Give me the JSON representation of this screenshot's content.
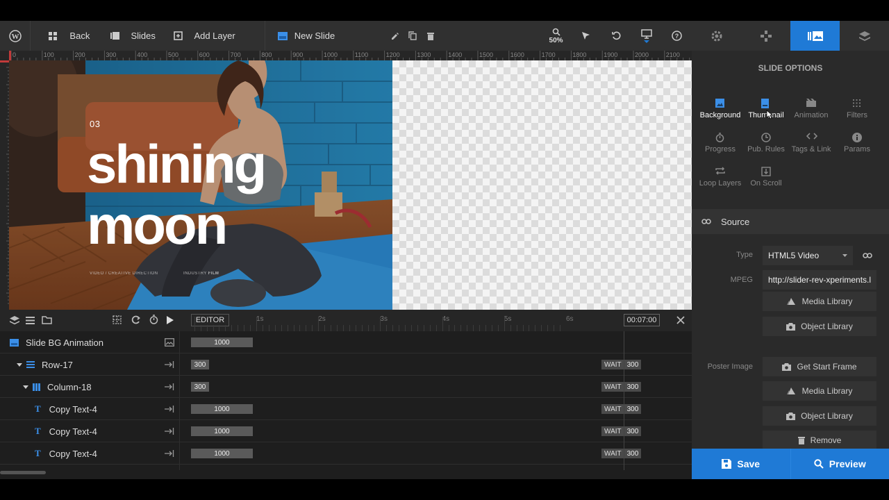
{
  "toolbar": {
    "back_label": "Back",
    "slides_label": "Slides",
    "add_layer_label": "Add Layer",
    "slide_name": "New Slide",
    "zoom": "50%"
  },
  "ruler": {
    "ticks": [
      "0",
      "100",
      "200",
      "300",
      "400",
      "500",
      "600",
      "700",
      "800",
      "900",
      "1000",
      "1100",
      "1200",
      "1300",
      "1400",
      "1500",
      "1600",
      "1700",
      "1800",
      "1900",
      "2000",
      "2100"
    ]
  },
  "slide": {
    "number": "03",
    "headline_line1": "shining",
    "headline_line2": "moon",
    "caption_left": "VIDEO / CREATIVE DIRECTION",
    "caption_right_a": "INDUSTRY",
    "caption_right_b": "FILM"
  },
  "timeline": {
    "editor_label": "EDITOR",
    "time_marks": [
      "1s",
      "2s",
      "3s",
      "4s",
      "5s",
      "6s"
    ],
    "time_display": "00:07:00",
    "rows": [
      {
        "name": "Slide BG Animation",
        "bar": "1000",
        "wait": "",
        "wait_val": ""
      },
      {
        "name": "Row-17",
        "bar": "300",
        "wait": "WAIT",
        "wait_val": "300"
      },
      {
        "name": "Column-18",
        "bar": "300",
        "wait": "WAIT",
        "wait_val": "300"
      },
      {
        "name": "Copy Text-4",
        "bar": "1000",
        "wait": "WAIT",
        "wait_val": "300"
      },
      {
        "name": "Copy Text-4",
        "bar": "1000",
        "wait": "WAIT",
        "wait_val": "300"
      },
      {
        "name": "Copy Text-4",
        "bar": "1000",
        "wait": "WAIT",
        "wait_val": "300"
      }
    ]
  },
  "panel": {
    "title": "SLIDE OPTIONS",
    "options": [
      "Background",
      "Thumbnail",
      "Animation",
      "Filters",
      "Progress",
      "Pub. Rules",
      "Tags & Link",
      "Params",
      "Loop Layers",
      "On Scroll"
    ],
    "source_label": "Source",
    "type_label": "Type",
    "type_value": "HTML5 Video",
    "mpeg_label": "MPEG",
    "mpeg_value": "http://slider-rev-xperiments.l",
    "media_library": "Media Library",
    "object_library": "Object Library",
    "poster_label": "Poster Image",
    "get_start_frame": "Get Start Frame",
    "remove": "Remove"
  },
  "actions": {
    "save": "Save",
    "preview": "Preview"
  },
  "colors": {
    "accent": "#1f7ad6",
    "toolbar": "#303030",
    "panel": "#2a2a2a",
    "timeline": "#1e1e1e"
  }
}
